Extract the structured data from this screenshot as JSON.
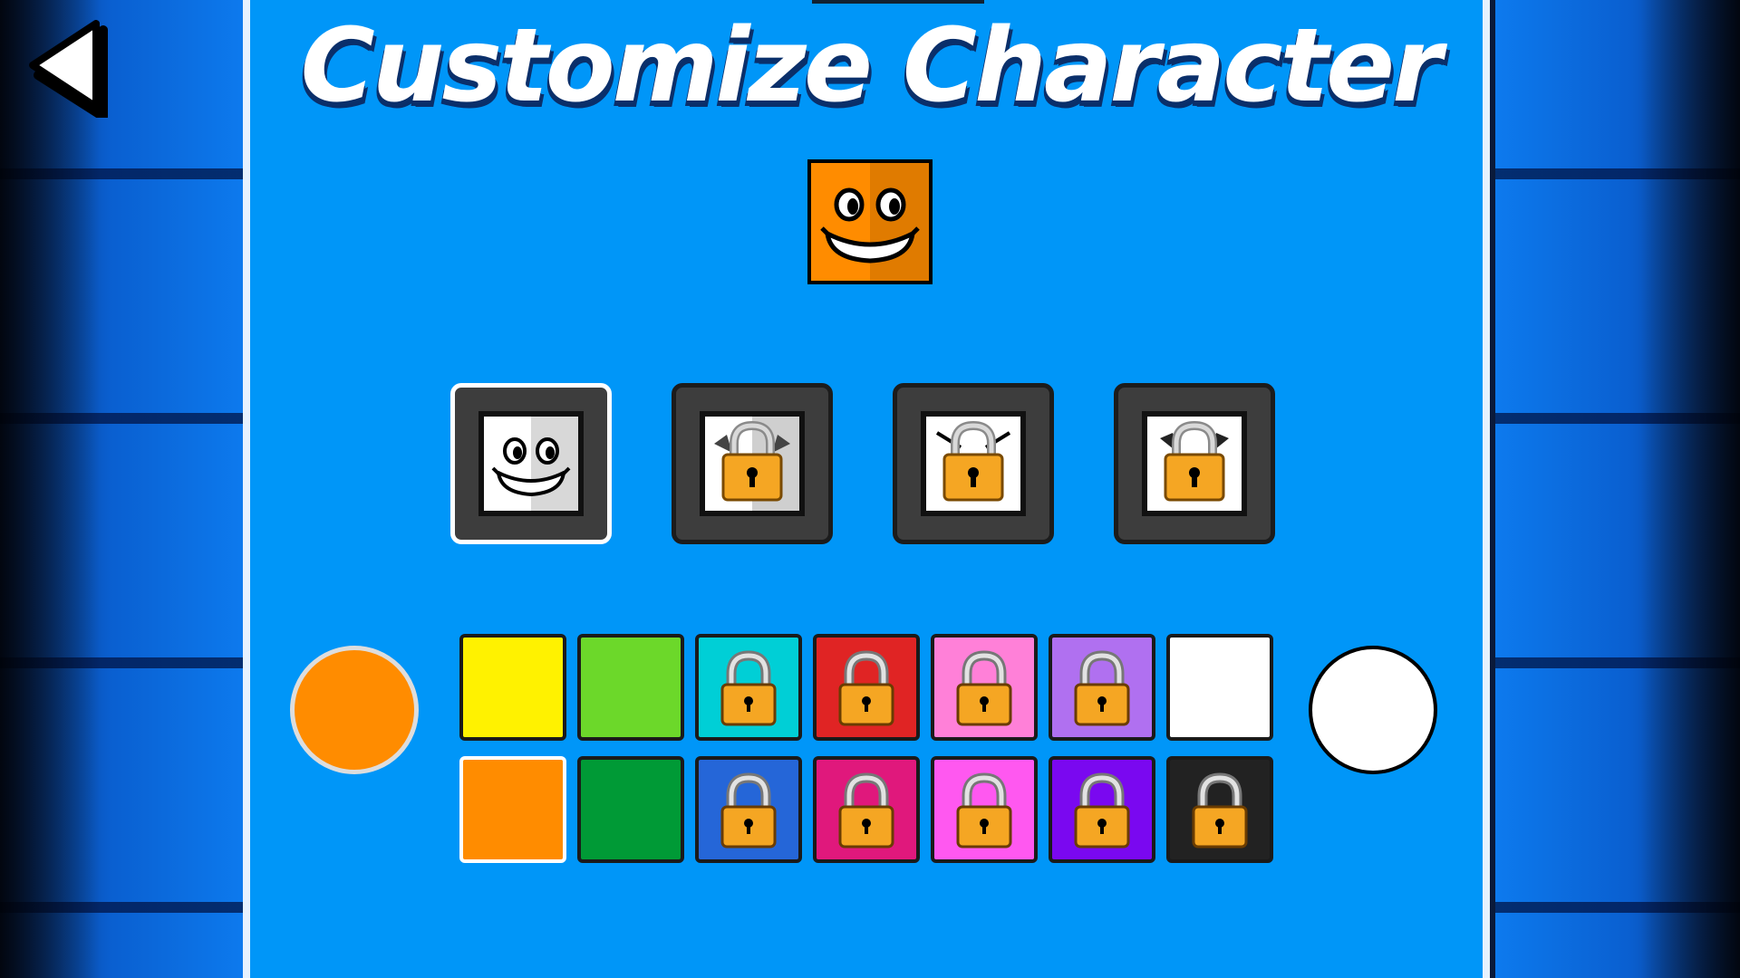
{
  "title": "Customize Character",
  "back_button": {
    "icon": "back-arrow-icon"
  },
  "preview": {
    "fill": "#FF8C00",
    "face": "grin-face-icon"
  },
  "faces": [
    {
      "id": "face-grin",
      "locked": false,
      "selected": true,
      "icon": "grin-face-icon"
    },
    {
      "id": "face-2",
      "locked": true,
      "selected": false,
      "icon": "lock-icon"
    },
    {
      "id": "face-3",
      "locked": true,
      "selected": false,
      "icon": "lock-icon"
    },
    {
      "id": "face-4",
      "locked": true,
      "selected": false,
      "icon": "lock-icon"
    }
  ],
  "primary_color": "#FF8C00",
  "secondary_color": "#FFFFFF",
  "palette": {
    "row1": [
      {
        "color": "#FFF200",
        "locked": false
      },
      {
        "color": "#6CD82A",
        "locked": false
      },
      {
        "color": "#00CFD6",
        "locked": true
      },
      {
        "color": "#E02424",
        "locked": true
      },
      {
        "color": "#FF80D8",
        "locked": true
      },
      {
        "color": "#B070F0",
        "locked": true
      },
      {
        "color": "#FFFFFF",
        "locked": false
      }
    ],
    "row2": [
      {
        "color": "#FF8C00",
        "locked": false,
        "selected": true
      },
      {
        "color": "#009A36",
        "locked": false
      },
      {
        "color": "#2566D8",
        "locked": true
      },
      {
        "color": "#E0187C",
        "locked": true
      },
      {
        "color": "#FF58F0",
        "locked": true
      },
      {
        "color": "#7A08F0",
        "locked": true
      },
      {
        "color": "#222222",
        "locked": true
      }
    ]
  }
}
